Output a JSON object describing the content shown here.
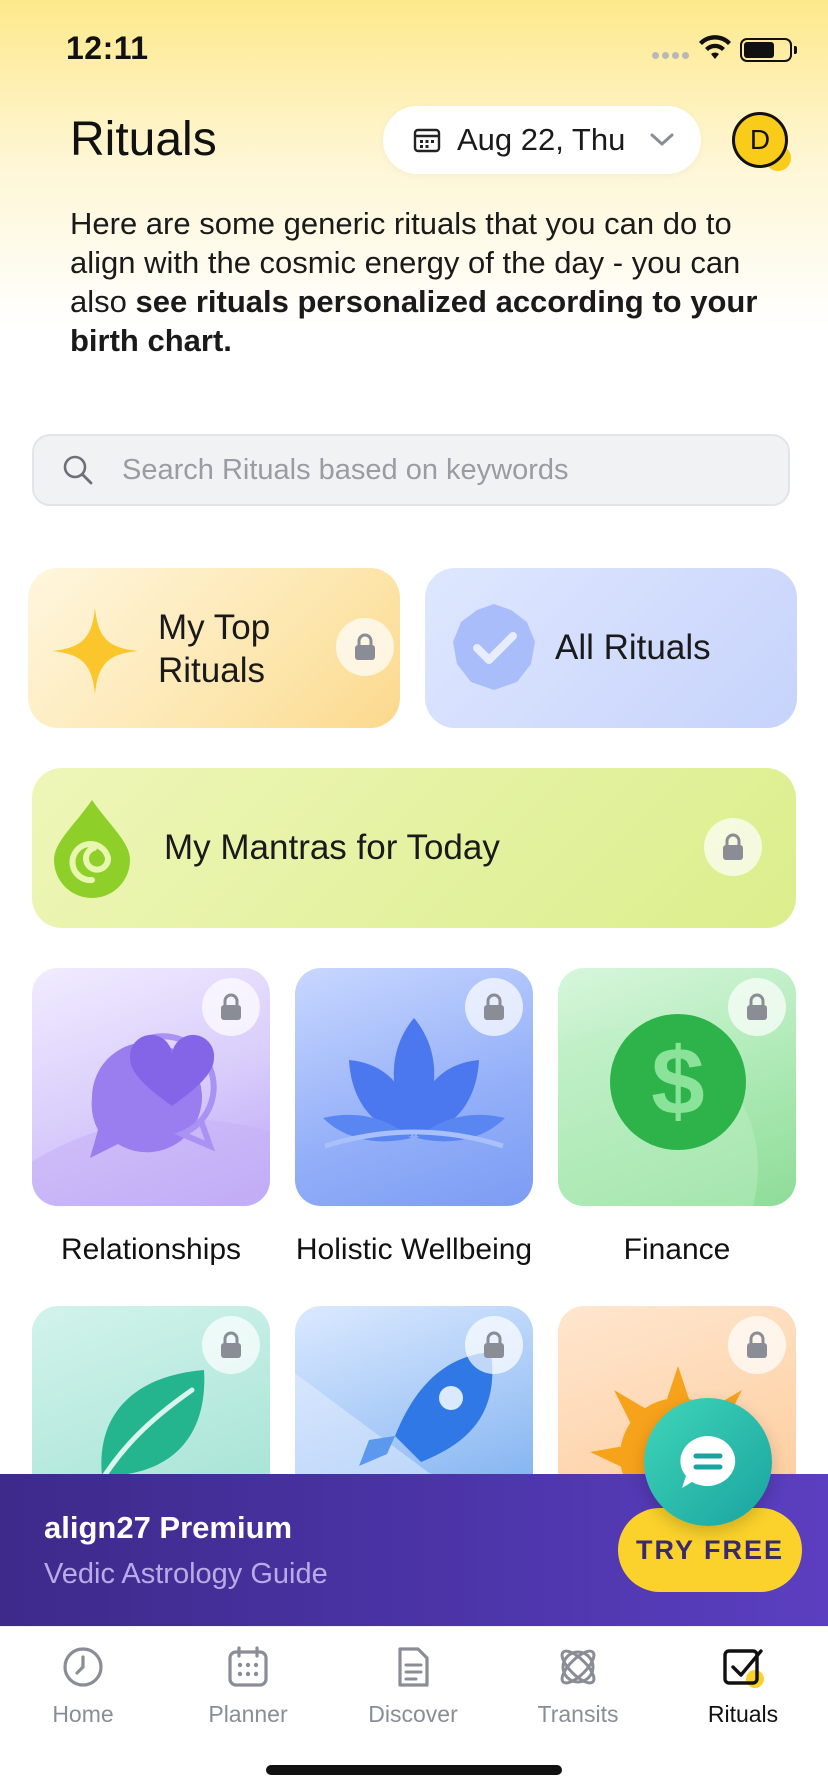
{
  "status_bar": {
    "time": "12:11"
  },
  "header": {
    "title": "Rituals",
    "date_label": "Aug 22, Thu",
    "avatar_initial": "D"
  },
  "intro": {
    "text_plain": "Here are some generic rituals that you can do to align with the cosmic energy of the day - you can also ",
    "text_bold": "see rituals personalized according to your birth chart."
  },
  "search": {
    "placeholder": "Search Rituals based on keywords"
  },
  "cards": {
    "top_rituals": "My Top Rituals",
    "all_rituals": "All Rituals",
    "mantras": "My Mantras for Today"
  },
  "categories": [
    {
      "label": "Relationships",
      "icon": "heart-chat-icon",
      "locked": true
    },
    {
      "label": "Holistic Wellbeing",
      "icon": "lotus-icon",
      "locked": true
    },
    {
      "label": "Finance",
      "icon": "dollar-icon",
      "locked": true
    },
    {
      "label": "",
      "icon": "leaf-icon",
      "locked": true
    },
    {
      "label": "",
      "icon": "rocket-icon",
      "locked": true
    },
    {
      "label": "",
      "icon": "sun-icon",
      "locked": true
    }
  ],
  "premium": {
    "title": "align27 Premium",
    "subtitle": "Vedic Astrology Guide",
    "cta": "TRY FREE"
  },
  "tabs": [
    {
      "label": "Home",
      "icon": "clock-icon",
      "active": false
    },
    {
      "label": "Planner",
      "icon": "calendar-icon",
      "active": false
    },
    {
      "label": "Discover",
      "icon": "document-icon",
      "active": false
    },
    {
      "label": "Transits",
      "icon": "atom-icon",
      "active": false
    },
    {
      "label": "Rituals",
      "icon": "checkbox-icon",
      "active": true
    }
  ],
  "colors": {
    "accent_yellow": "#fbd22b",
    "premium_purple": "#4c34a8",
    "chat_teal": "#1aa3a0"
  }
}
